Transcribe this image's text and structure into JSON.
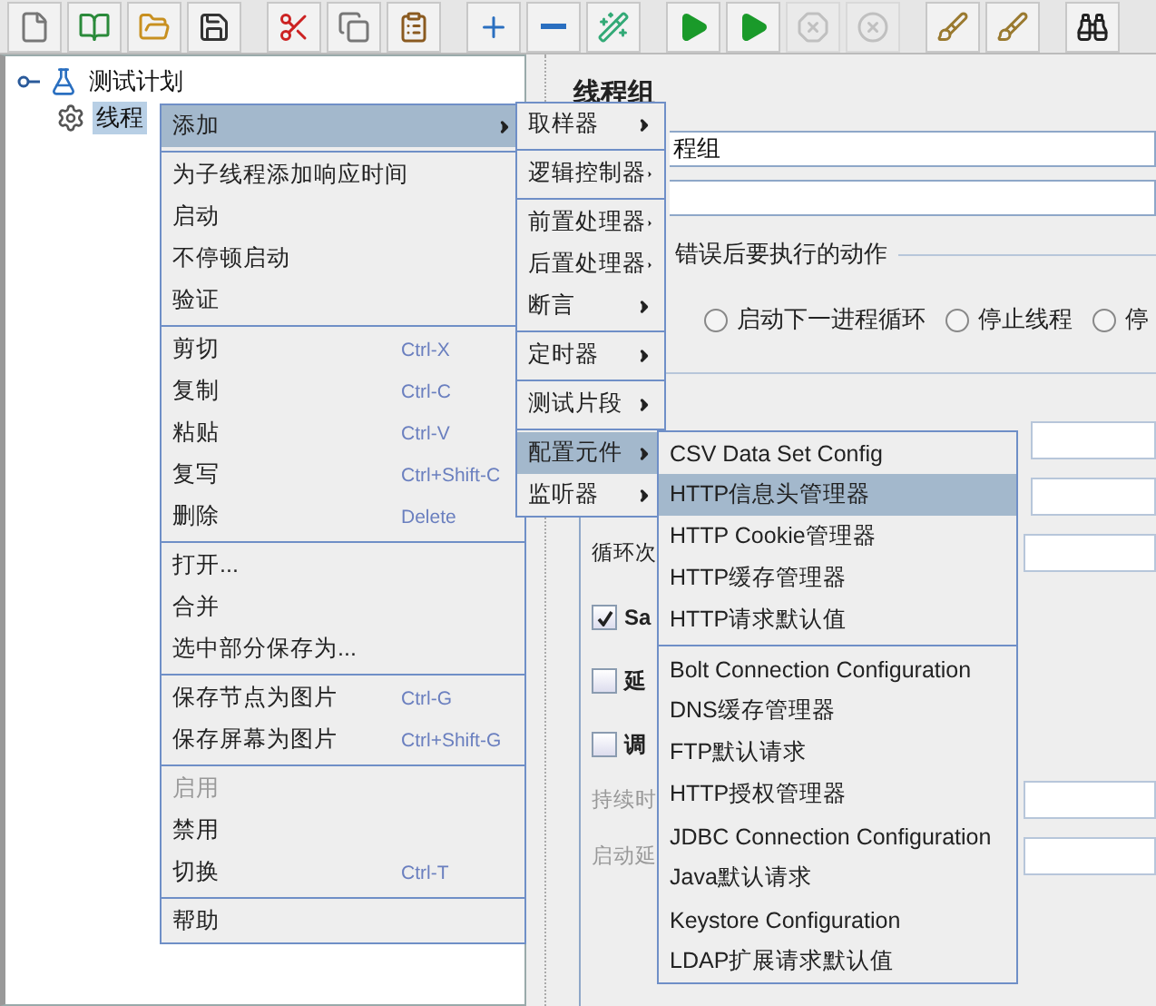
{
  "toolbar": [
    {
      "kind": "new",
      "disabled": false
    },
    {
      "kind": "templates",
      "disabled": false
    },
    {
      "kind": "open",
      "disabled": false
    },
    {
      "kind": "save",
      "disabled": false
    },
    {
      "kind": "sep"
    },
    {
      "kind": "cut",
      "disabled": false
    },
    {
      "kind": "copy",
      "disabled": false
    },
    {
      "kind": "paste",
      "disabled": false
    },
    {
      "kind": "sep"
    },
    {
      "kind": "expand",
      "disabled": false
    },
    {
      "kind": "collapse",
      "disabled": false
    },
    {
      "kind": "toggle",
      "disabled": false
    },
    {
      "kind": "sep"
    },
    {
      "kind": "start",
      "disabled": false
    },
    {
      "kind": "start_no_pause",
      "disabled": false
    },
    {
      "kind": "stop",
      "disabled": true
    },
    {
      "kind": "shutdown",
      "disabled": true
    },
    {
      "kind": "sep"
    },
    {
      "kind": "clear",
      "disabled": false
    },
    {
      "kind": "clear_all",
      "disabled": false
    },
    {
      "kind": "sep"
    },
    {
      "kind": "search",
      "disabled": false
    }
  ],
  "tree": [
    {
      "label": "测试计划",
      "kind": "plan",
      "expanded": true,
      "selected": false,
      "children": [
        {
          "label": "线程",
          "kind": "thread_group",
          "selected": true
        }
      ]
    }
  ],
  "panel": {
    "title": "线程组",
    "name_value": "程组",
    "error_action": {
      "legend": "错误后要执行的动作",
      "options": [
        {
          "label": "启动下一进程循环",
          "selected": false
        },
        {
          "label": "停止线程",
          "selected": false
        },
        {
          "label": "停",
          "selected": false
        }
      ]
    },
    "loop_label": "循环次",
    "checkboxes": [
      {
        "label": "Sa",
        "checked": true
      },
      {
        "label": "延",
        "checked": false
      },
      {
        "label": "调",
        "checked": false
      }
    ],
    "disabled_labels": [
      "持续时",
      "启动延"
    ]
  },
  "context_menu": [
    {
      "kind": "submenu",
      "label": "添加",
      "selected": true,
      "disabled": false
    },
    {
      "kind": "separator"
    },
    {
      "kind": "item",
      "label": "为子线程添加响应时间",
      "selected": false,
      "disabled": false
    },
    {
      "kind": "item",
      "label": "启动",
      "selected": false,
      "disabled": false
    },
    {
      "kind": "item",
      "label": "不停顿启动",
      "selected": false,
      "disabled": false
    },
    {
      "kind": "item",
      "label": "验证",
      "selected": false,
      "disabled": false
    },
    {
      "kind": "separator"
    },
    {
      "kind": "item",
      "label": "剪切",
      "shortcut": "Ctrl-X",
      "selected": false,
      "disabled": false
    },
    {
      "kind": "item",
      "label": "复制",
      "shortcut": "Ctrl-C",
      "selected": false,
      "disabled": false
    },
    {
      "kind": "item",
      "label": "粘贴",
      "shortcut": "Ctrl-V",
      "selected": false,
      "disabled": false
    },
    {
      "kind": "item",
      "label": "复写",
      "shortcut": "Ctrl+Shift-C",
      "selected": false,
      "disabled": false
    },
    {
      "kind": "item",
      "label": "删除",
      "shortcut": "Delete",
      "selected": false,
      "disabled": false
    },
    {
      "kind": "separator"
    },
    {
      "kind": "item",
      "label": "打开...",
      "selected": false,
      "disabled": false
    },
    {
      "kind": "item",
      "label": "合并",
      "selected": false,
      "disabled": false
    },
    {
      "kind": "item",
      "label": "选中部分保存为...",
      "selected": false,
      "disabled": false
    },
    {
      "kind": "separator"
    },
    {
      "kind": "item",
      "label": "保存节点为图片",
      "shortcut": "Ctrl-G",
      "selected": false,
      "disabled": false
    },
    {
      "kind": "item",
      "label": "保存屏幕为图片",
      "shortcut": "Ctrl+Shift-G",
      "selected": false,
      "disabled": false
    },
    {
      "kind": "separator"
    },
    {
      "kind": "item",
      "label": "启用",
      "selected": false,
      "disabled": true
    },
    {
      "kind": "item",
      "label": "禁用",
      "selected": false,
      "disabled": false
    },
    {
      "kind": "item",
      "label": "切换",
      "shortcut": "Ctrl-T",
      "selected": false,
      "disabled": false
    },
    {
      "kind": "separator"
    },
    {
      "kind": "item",
      "label": "帮助",
      "selected": false,
      "disabled": false
    }
  ],
  "add_submenu": [
    {
      "kind": "submenu",
      "label": "取样器",
      "selected": false
    },
    {
      "kind": "separator"
    },
    {
      "kind": "submenu",
      "label": "逻辑控制器",
      "selected": false
    },
    {
      "kind": "separator"
    },
    {
      "kind": "submenu",
      "label": "前置处理器",
      "selected": false
    },
    {
      "kind": "submenu",
      "label": "后置处理器",
      "selected": false
    },
    {
      "kind": "submenu",
      "label": "断言",
      "selected": false
    },
    {
      "kind": "separator"
    },
    {
      "kind": "submenu",
      "label": "定时器",
      "selected": false
    },
    {
      "kind": "separator"
    },
    {
      "kind": "submenu",
      "label": "测试片段",
      "selected": false
    },
    {
      "kind": "separator"
    },
    {
      "kind": "submenu",
      "label": "配置元件",
      "selected": true
    },
    {
      "kind": "submenu",
      "label": "监听器",
      "selected": false
    }
  ],
  "config_submenu": [
    {
      "kind": "item",
      "label": "CSV Data Set Config",
      "selected": false
    },
    {
      "kind": "item",
      "label": "HTTP信息头管理器",
      "selected": true
    },
    {
      "kind": "item",
      "label": "HTTP Cookie管理器",
      "selected": false
    },
    {
      "kind": "item",
      "label": "HTTP缓存管理器",
      "selected": false
    },
    {
      "kind": "item",
      "label": "HTTP请求默认值",
      "selected": false
    },
    {
      "kind": "separator"
    },
    {
      "kind": "item",
      "label": "Bolt Connection Configuration",
      "selected": false
    },
    {
      "kind": "item",
      "label": "DNS缓存管理器",
      "selected": false
    },
    {
      "kind": "item",
      "label": "FTP默认请求",
      "selected": false
    },
    {
      "kind": "item",
      "label": "HTTP授权管理器",
      "selected": false
    },
    {
      "kind": "item",
      "label": "JDBC Connection Configuration",
      "selected": false
    },
    {
      "kind": "item",
      "label": "Java默认请求",
      "selected": false
    },
    {
      "kind": "item",
      "label": "Keystore Configuration",
      "selected": false
    },
    {
      "kind": "item",
      "label": "LDAP扩展请求默认值",
      "selected": false
    }
  ]
}
